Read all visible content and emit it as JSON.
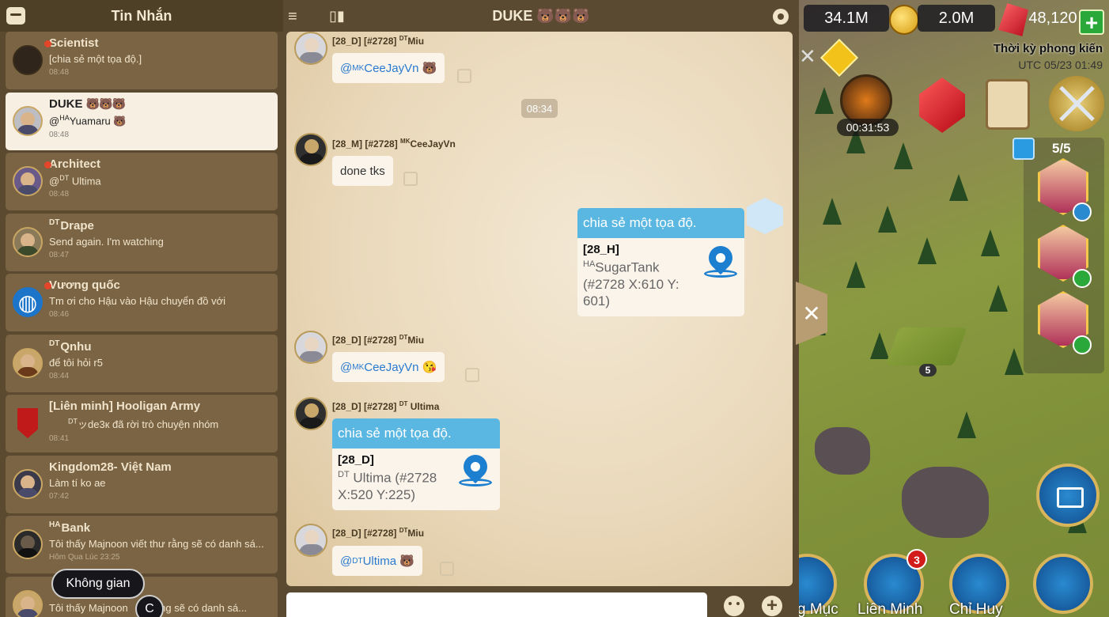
{
  "chat_list": {
    "title": "Tin Nhắn",
    "items": [
      {
        "tag": "",
        "name": "Scientist",
        "preview": "[chia sẻ một tọa độ.]",
        "time": "08:48",
        "unread": true
      },
      {
        "tag": "",
        "name": "DUKE",
        "name_suffix": "🐻🐻🐻",
        "preview_tag": "HA",
        "preview": "Yuamaru 🐻",
        "preview_prefix": "@",
        "time": "08:48",
        "unread": false,
        "selected": true
      },
      {
        "tag": "",
        "name": "Architect",
        "preview_prefix": "@",
        "preview_tag": "DT",
        "preview": " Ultima",
        "time": "08:48",
        "unread": true
      },
      {
        "tag": "DT",
        "name": "Drape",
        "preview": "Send again. I'm watching",
        "time": "08:47",
        "unread": false
      },
      {
        "tag": "",
        "name": "Vương quốc",
        "preview": "Tm ơi cho Hậu vào Hậu chuyển đồ với",
        "time": "08:46",
        "unread": true
      },
      {
        "tag": "DT",
        "name": "Qnhu",
        "preview": "để tôi hỏi r5",
        "time": "08:44",
        "unread": false
      },
      {
        "tag": "",
        "name": "[Liên minh] Hooligan Army",
        "preview_tag": "DT",
        "preview": "ッde3к đã rời trò chuyện nhóm",
        "time": "08:41",
        "unread": false
      },
      {
        "tag": "",
        "name": "Kingdom28- Việt Nam",
        "preview": "Làm tí ko ae",
        "time": "07:42",
        "unread": false
      },
      {
        "tag": "HA",
        "name": "Bank",
        "preview": "Tôi thấy Majnoon viết thư rằng sẽ có danh sá...",
        "time": "Hôm Qua Lúc 23:25",
        "unread": false
      },
      {
        "tag": "",
        "name": "",
        "preview": "Tôi thấy Majnoon",
        "preview2": "rằng sẽ có danh sá...",
        "time": "",
        "unread": false
      }
    ]
  },
  "tooltip": {
    "text": "Không gian",
    "key": "C"
  },
  "conversation": {
    "title": "DUKE 🐻🐻🐻",
    "timestamp": "08:34",
    "messages": [
      {
        "sender": "[28_D] [#2728] ",
        "sender_tag": "DT",
        "sender_name": "Miu",
        "mention_tag": "MK",
        "mention": "CeeJayVn",
        "emoji": "🐻"
      },
      {
        "sender": "[28_M] [#2728] ",
        "sender_tag": "MK",
        "sender_name": "CeeJayVn",
        "text": "done tks"
      },
      {
        "share": "chia sẻ một tọa độ.",
        "loc_title": "[28_H]",
        "loc_tag": "HA",
        "loc_name": "SugarTank",
        "loc_detail": "(#2728 X:610 Y: 601)"
      },
      {
        "sender": "[28_D] [#2728] ",
        "sender_tag": "DT",
        "sender_name": "Miu",
        "mention_tag": "MK",
        "mention": "CeeJayVn",
        "emoji": "😘"
      },
      {
        "sender": "[28_D] [#2728] ",
        "sender_tag": "DT",
        "sender_name": " Ultima",
        "share": "chia sẻ một tọa độ.",
        "loc_title": "[28_D]",
        "loc_tag": "DT",
        "loc_name": " Ultima (#2728",
        "loc_detail": "X:520 Y:225)"
      },
      {
        "sender": "[28_D] [#2728] ",
        "sender_tag": "DT",
        "sender_name": "Miu",
        "mention_tag": "DT",
        "mention": " Ultima",
        "emoji": "🐻"
      }
    ]
  },
  "game": {
    "resources": {
      "stone": "34.1M",
      "gold": "2.0M",
      "gems": "48,120"
    },
    "era": "Thời kỳ phong kiến",
    "utc": "UTC 05/23 01:49",
    "timer": "00:31:53",
    "commanders_count": "5/5",
    "city_level": "5",
    "alliance_badge": "3",
    "nav": [
      {
        "label": "g Mục"
      },
      {
        "label": "Liên Minh"
      },
      {
        "label": "Chỉ Huy"
      }
    ]
  },
  "colors": {
    "accent": "#5ab7e2",
    "link": "#2a7ad0",
    "panel": "#7b6443",
    "selected": "#f7efe2"
  }
}
